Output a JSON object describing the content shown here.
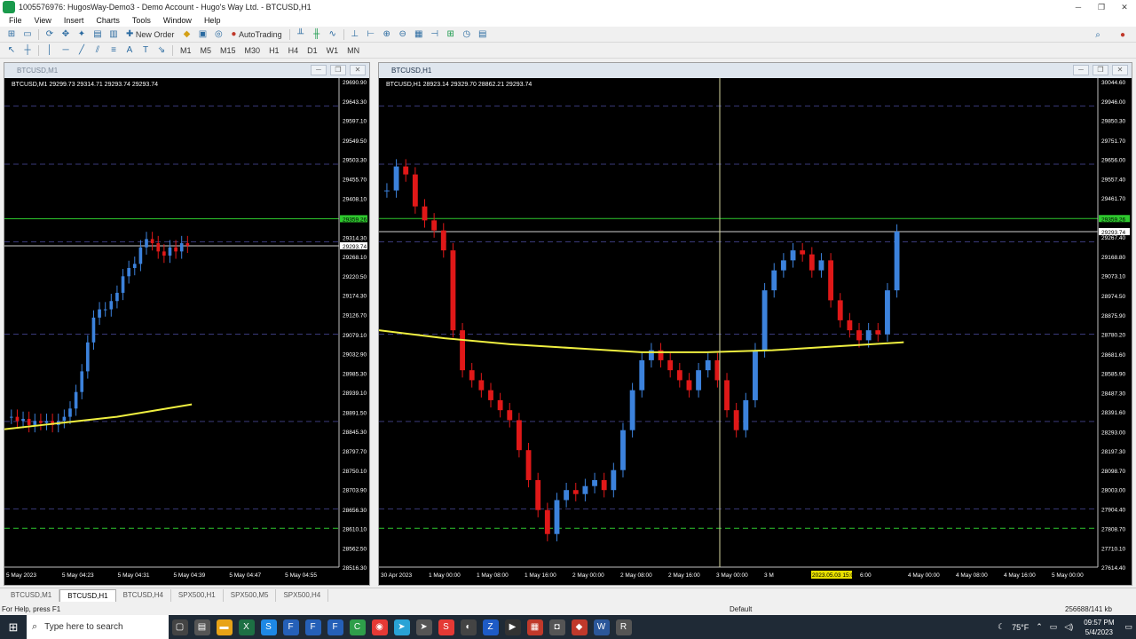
{
  "window": {
    "title": "1005576976: HugosWay-Demo3 - Demo Account - Hugo's Way Ltd. - BTCUSD,H1",
    "buttons": [
      "─",
      "❐",
      "✕"
    ]
  },
  "menu": [
    "File",
    "View",
    "Insert",
    "Charts",
    "Tools",
    "Window",
    "Help"
  ],
  "toolbar": {
    "new_order": "New Order",
    "auto_trading": "AutoTrading",
    "timeframes": [
      "M1",
      "M5",
      "M15",
      "M30",
      "H1",
      "H4",
      "D1",
      "W1",
      "MN"
    ]
  },
  "chart_left": {
    "window_title": "BTCUSD,M1",
    "info": "BTCUSD,M1  29299.73 29314.71 29293.74 29293.74",
    "price_labels": [
      "29690.90",
      "29643.30",
      "29597.10",
      "29549.50",
      "29503.30",
      "29455.70",
      "29408.10",
      "29359.26",
      "29314.30",
      "29293.74",
      "29268.10",
      "29220.50",
      "29174.30",
      "29126.70",
      "29079.10",
      "29032.90",
      "28985.30",
      "28939.10",
      "28891.50",
      "28845.30",
      "28797.70",
      "28750.10",
      "28703.90",
      "28656.30",
      "28610.10",
      "28562.50",
      "28516.30"
    ],
    "green_label": "29359.26",
    "white_label": "29293.74",
    "time_labels": [
      "5 May 2023",
      "5 May 04:23",
      "5 May 04:31",
      "5 May 04:39",
      "5 May 04:47",
      "5 May 04:55"
    ]
  },
  "chart_right": {
    "window_title": "BTCUSD,H1",
    "info": "BTCUSD,H1  28923.14 29329.70 28862.21 29293.74",
    "price_labels": [
      "30044.60",
      "29946.00",
      "29850.30",
      "29751.70",
      "29656.00",
      "29557.40",
      "29461.70",
      "29363.10",
      "29267.40",
      "29168.80",
      "29073.10",
      "28974.50",
      "28875.90",
      "28780.20",
      "28681.60",
      "28585.90",
      "28487.30",
      "28391.60",
      "28293.00",
      "28197.30",
      "28098.70",
      "28003.00",
      "27904.40",
      "27808.70",
      "27710.10",
      "27614.40"
    ],
    "green_label": "29359.26",
    "white_label": "29293.74",
    "time_labels": [
      "30 Apr 2023",
      "1 May 00:00",
      "1 May 08:00",
      "1 May 16:00",
      "2 May 00:00",
      "2 May 08:00",
      "2 May 16:00",
      "3 May 00:00",
      "3 M",
      "2023.05.03 15:00",
      "6:00",
      "4 May 00:00",
      "4 May 08:00",
      "4 May 16:00",
      "5 May 00:00"
    ],
    "crosshair_label": "2023.05.03 15:00"
  },
  "chart_data": [
    {
      "type": "candlestick",
      "title": "BTCUSD,M1",
      "ylim": [
        28516.3,
        29690.9
      ],
      "up_color": "#3c82dc",
      "down_color": "#e01818",
      "ma_color": "#f0f040",
      "series": [
        {
          "name": "BTCUSD,M1",
          "close": [
            28880,
            28870,
            28875,
            28860,
            28870,
            28865,
            28870,
            28860,
            28870,
            28880,
            28900,
            28940,
            28990,
            29060,
            29120,
            29140,
            29140,
            29160,
            29180,
            29220,
            29240,
            29250,
            29290,
            29310,
            29300,
            29280,
            29270,
            29290,
            29280,
            29300,
            29294
          ]
        }
      ],
      "ma": [
        28850,
        28860,
        28870,
        28880,
        28895,
        28910
      ]
    },
    {
      "type": "candlestick",
      "title": "BTCUSD,H1",
      "ylim": [
        27614.4,
        30044.6
      ],
      "up_color": "#3c82dc",
      "down_color": "#e01818",
      "ma_color": "#f0f040",
      "series": [
        {
          "name": "BTCUSD,H1",
          "close": [
            29500,
            29620,
            29580,
            29420,
            29350,
            29300,
            29200,
            28800,
            28600,
            28550,
            28500,
            28450,
            28400,
            28350,
            28200,
            28050,
            27900,
            27780,
            27950,
            28000,
            27980,
            28020,
            28050,
            28000,
            28100,
            28300,
            28500,
            28650,
            28700,
            28650,
            28600,
            28550,
            28500,
            28600,
            28650,
            28550,
            28400,
            28300,
            28450,
            28700,
            29000,
            29100,
            29150,
            29200,
            29180,
            29100,
            29150,
            28950,
            28850,
            28800,
            28750,
            28800,
            28780,
            29000,
            29294
          ]
        }
      ],
      "ma": [
        28800,
        28760,
        28730,
        28710,
        28690,
        28690,
        28700,
        28720,
        28740
      ]
    }
  ],
  "tabs": [
    "BTCUSD,M1",
    "BTCUSD,H1",
    "BTCUSD,H4",
    "SPX500,H1",
    "SPX500,M5",
    "SPX500,H4"
  ],
  "status": {
    "help": "For Help, press F1",
    "profile": "Default",
    "connection": "256688/141 kb"
  },
  "taskbar": {
    "search_placeholder": "Type here to search",
    "weather": "75°F",
    "time": "09:57 PM",
    "date": "5/4/2023"
  }
}
